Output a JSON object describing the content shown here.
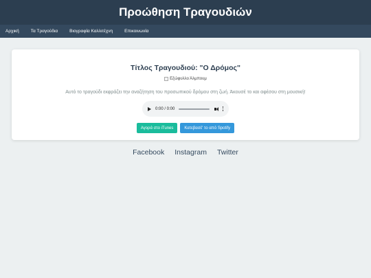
{
  "header": {
    "title": "Προώθηση Τραγουδιών"
  },
  "nav": {
    "items": [
      {
        "label": "Αρχική"
      },
      {
        "label": "Τα Τραγούδια"
      },
      {
        "label": "Βιογραφία Καλλιτέχνη"
      },
      {
        "label": "Επικοινωνία"
      }
    ]
  },
  "song": {
    "title": "Τίτλος Τραγουδιού: \"Ο Δρόμος\"",
    "cover_alt": "Εξώφυλλο Άλμπουμ",
    "description": "Αυτό το τραγούδι εκφράζει την αναζήτηση του προσωπικού δρόμου στη ζωή. Άκουσέ το και αφέσου στη μουσική!",
    "player": {
      "time": "0:00 / 0:00"
    },
    "buttons": {
      "itunes": "Αγορά στο iTunes",
      "spotify": "Κατεβασέ' το από Spotify"
    }
  },
  "social": [
    {
      "label": "Facebook"
    },
    {
      "label": "Instagram"
    },
    {
      "label": "Twitter"
    }
  ]
}
